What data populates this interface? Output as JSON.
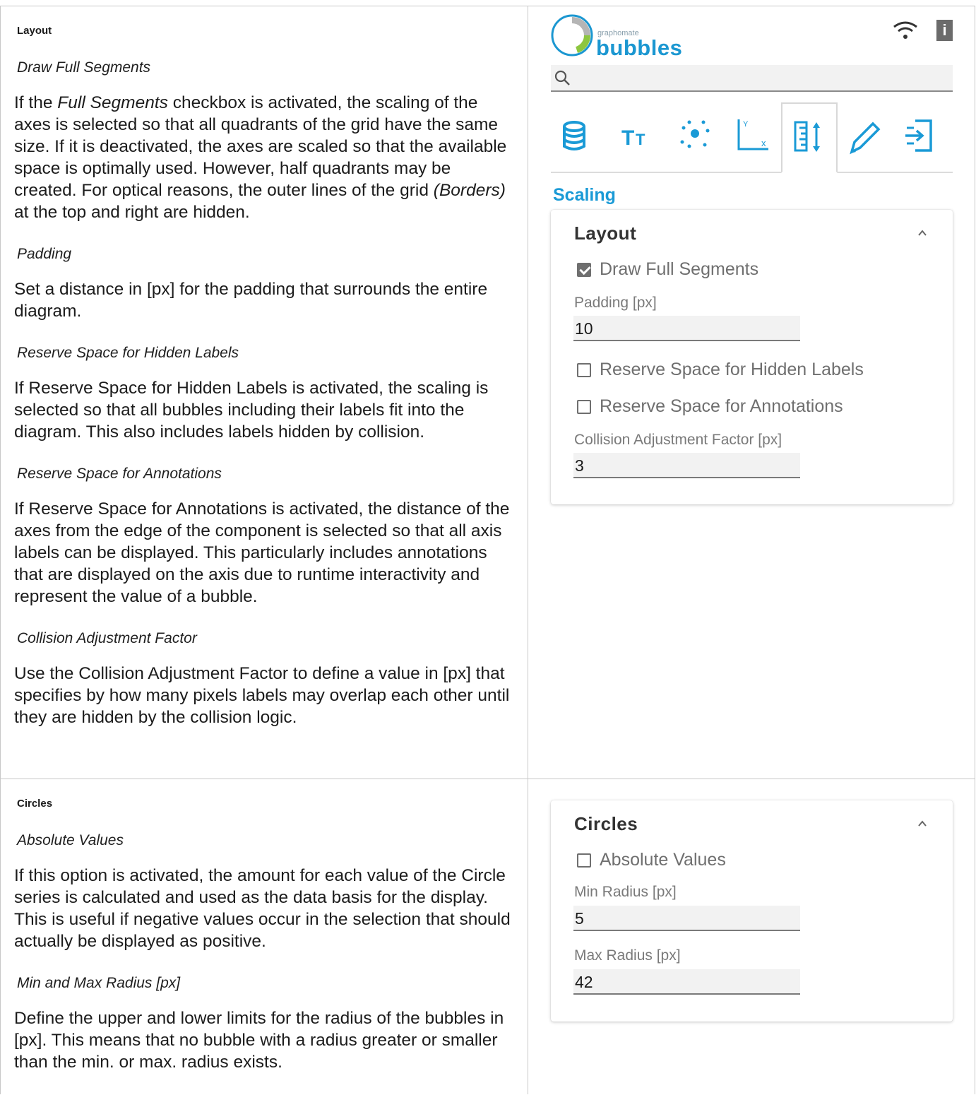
{
  "layout_section": {
    "title": "Layout",
    "items": [
      {
        "heading": "Draw Full Segments",
        "text_pre": "If the ",
        "text_em": "Full Segments",
        "text_mid": " checkbox is activated, the scaling of the axes is selected so that all quadrants of the grid have the same size. If it is deactivated, the axes are scaled so that the available space is optimally used. However, half quadrants may be created. For optical reasons, the outer lines of the grid ",
        "text_em2": "(Borders)",
        "text_post": " at the top and right are hidden."
      },
      {
        "heading": "Padding",
        "text": "Set a distance in [px] for the padding that surrounds the entire diagram."
      },
      {
        "heading": "Reserve Space for Hidden Labels",
        "text": "If Reserve Space for Hidden Labels is activated, the scaling is selected so that all bubbles including their labels fit into the diagram. This also includes labels hidden by collision."
      },
      {
        "heading": "Reserve Space for Annotations",
        "text": "If Reserve Space for Annotations is activated, the distance of the axes from the edge of the component is selected so that all axis labels can be displayed. This particularly includes annotations that are displayed on the axis due to runtime interactivity and represent the value of a bubble."
      },
      {
        "heading": "Collision Adjustment Factor",
        "text": "Use the Collision Adjustment Factor to define a value in [px] that specifies by how many pixels labels may overlap each other until they are hidden by the collision logic."
      }
    ]
  },
  "circles_section": {
    "title": "Circles",
    "items": [
      {
        "heading": "Absolute Values",
        "text": "If this option is activated, the amount for each value of the Circle series is calculated and used as the data basis for the display. This is useful if negative values occur in the selection that should actually be displayed as positive."
      },
      {
        "heading": "Min and Max Radius [px]",
        "text": "Define the upper and lower limits for the radius of the bubbles in [px]. This means that no bubble with a radius greater or smaller than the min. or max. radius exists."
      }
    ]
  },
  "panel": {
    "logo_small": "graphomate",
    "logo_big": "bubbles",
    "info_label": "i",
    "search_placeholder": "",
    "tabs": [
      "database-icon",
      "text-icon",
      "scatter-icon",
      "axis-icon",
      "scaling-icon",
      "pencil-icon",
      "export-icon"
    ],
    "active_tab": "scaling-icon",
    "section_title": "Scaling",
    "layout_card": {
      "title": "Layout",
      "draw_full_segments": {
        "label": "Draw Full Segments",
        "checked": true
      },
      "padding_label": "Padding [px]",
      "padding_value": "10",
      "reserve_hidden": {
        "label": "Reserve Space for Hidden Labels",
        "checked": false
      },
      "reserve_annotations": {
        "label": "Reserve Space for Annotations",
        "checked": false
      },
      "collision_label": "Collision Adjustment Factor [px]",
      "collision_value": "3"
    },
    "circles_card": {
      "title": "Circles",
      "absolute_values": {
        "label": "Absolute Values",
        "checked": false
      },
      "min_radius_label": "Min Radius [px]",
      "min_radius_value": "5",
      "max_radius_label": "Max Radius [px]",
      "max_radius_value": "42"
    },
    "colors": {
      "accent": "#1a9ad6",
      "logo_green": "#8dc63f"
    }
  }
}
